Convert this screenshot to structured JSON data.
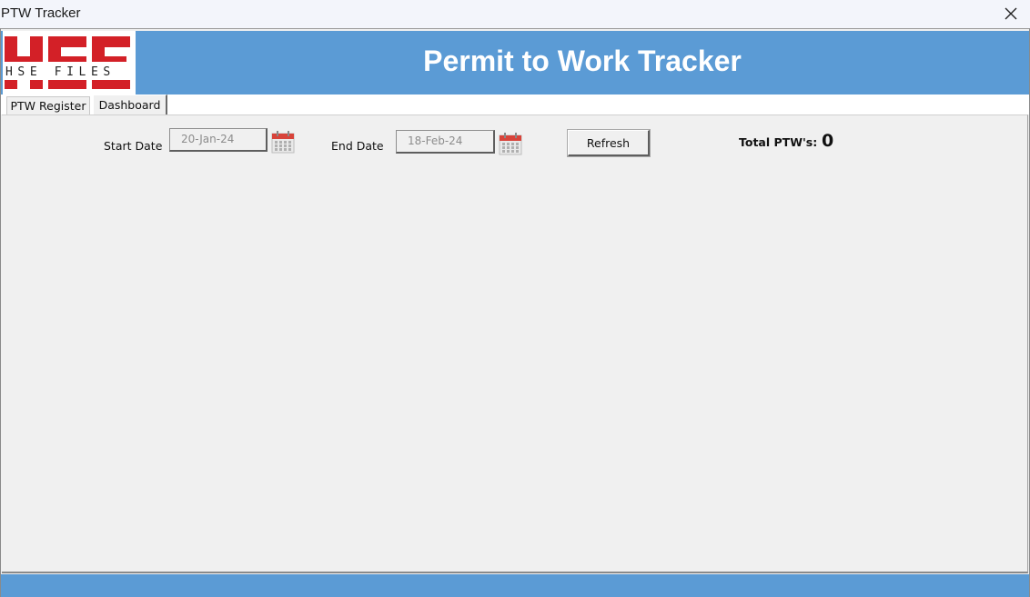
{
  "window": {
    "title": "PTW Tracker",
    "close_icon": "close-icon"
  },
  "header": {
    "title": "Permit to Work Tracker",
    "logo_text": "HSE",
    "logo_subtext": "HSE FILES",
    "background_color": "#5b9bd5",
    "logo_color": "#d32027"
  },
  "tabs": [
    {
      "label": "PTW Register",
      "selected": false
    },
    {
      "label": "Dashboard",
      "selected": true
    }
  ],
  "dashboard": {
    "start_date_label": "Start Date",
    "start_date_value": "20-Jan-24",
    "end_date_label": "End Date",
    "end_date_value": "18-Feb-24",
    "calendar_icon": "calendar-icon",
    "refresh_label": "Refresh",
    "total_label": "Total PTW's:",
    "total_value": "0"
  },
  "footer": {
    "background_color": "#5b9bd5"
  }
}
